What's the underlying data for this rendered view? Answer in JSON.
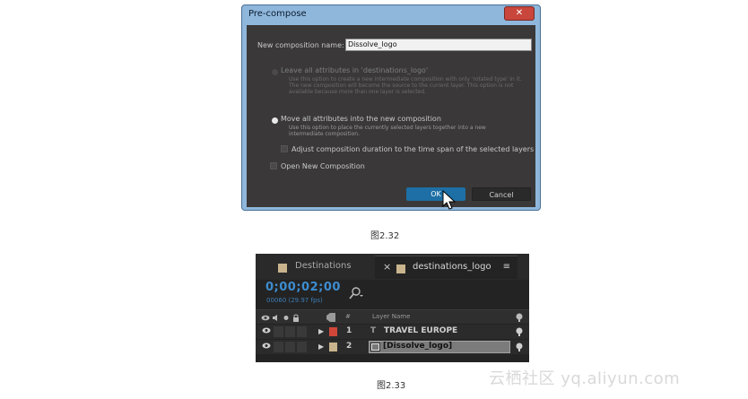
{
  "dialog": {
    "title": "Pre-compose",
    "close_glyph": "✕",
    "name_label": "New composition name:",
    "name_value": "Dissolve_logo",
    "option1_label": "Leave all attributes in 'destinations_logo'",
    "option1_desc": "Use this option to create a new intermediate composition with only 'rotated type' in it. The new composition will become the source to the current layer. This option is not available because more than one layer is selected.",
    "option2_label": "Move all attributes into the new composition",
    "option2_desc": "Use this option to place the currently selected layers together into a new intermediate composition.",
    "adjust_label": "Adjust composition duration to the time span of the selected layers",
    "open_label": "Open New Composition",
    "ok_label": "OK",
    "cancel_label": "Cancel"
  },
  "captions": {
    "fig1": "图2.32",
    "fig2": "图2.33"
  },
  "timeline": {
    "tab1": "Destinations",
    "tab2": "destinations_logo",
    "tab2_close": "×",
    "tab2_menu": "≡",
    "timecode": "0;00;02;00",
    "fps": "00060 (29.97 fps)",
    "header_hash": "#",
    "header_layer": "Layer Name",
    "rows": [
      {
        "num": "1",
        "name": "TRAVEL EUROPE",
        "color": "#d0473a"
      },
      {
        "num": "2",
        "name": "[Dissolve_logo]",
        "color": "#c9b48d"
      }
    ]
  },
  "watermark": "云栖社区 yq.aliyun.com"
}
